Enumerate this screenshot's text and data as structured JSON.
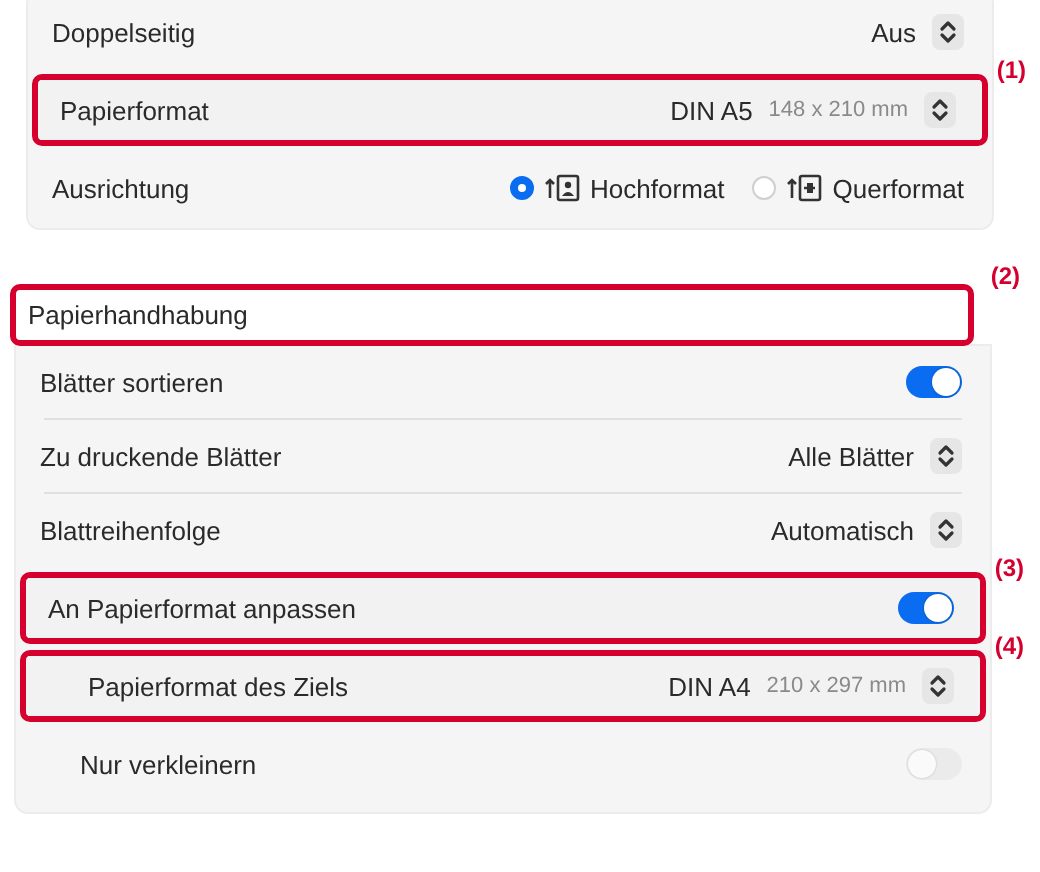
{
  "print_options": {
    "rows": [
      {
        "kind": "popup",
        "label": "Doppelseitig",
        "value": "Aus",
        "highlighted": false
      },
      {
        "kind": "popup",
        "label": "Papierformat",
        "value": "DIN A5",
        "detail": "148 x 210 mm",
        "highlighted": true,
        "callout": "(1)"
      },
      {
        "kind": "radio",
        "label": "Ausrichtung",
        "highlighted": false,
        "options": [
          {
            "label": "Hochformat",
            "selected": true
          },
          {
            "label": "Querformat",
            "selected": false
          }
        ]
      }
    ]
  },
  "paper_handling": {
    "title": "Papierhandhabung",
    "callout": "(2)",
    "rows": [
      {
        "kind": "toggle",
        "label": "Blätter sortieren",
        "on": true,
        "disabled": false,
        "highlighted": false
      },
      {
        "kind": "popup",
        "label": "Zu druckende Blätter",
        "value": "Alle Blätter",
        "highlighted": false
      },
      {
        "kind": "popup",
        "label": "Blattreihenfolge",
        "value": "Automatisch",
        "highlighted": false
      },
      {
        "kind": "toggle",
        "label": "An Papierformat anpassen",
        "on": true,
        "disabled": false,
        "highlighted": true,
        "callout": "(3)",
        "children": [
          {
            "kind": "popup",
            "label": "Papierformat des Ziels",
            "value": "DIN A4",
            "detail": "210 x 297 mm",
            "highlighted": true,
            "callout": "(4)"
          },
          {
            "kind": "toggle",
            "label": "Nur verkleinern",
            "on": false,
            "disabled": true,
            "highlighted": false
          }
        ]
      }
    ]
  }
}
